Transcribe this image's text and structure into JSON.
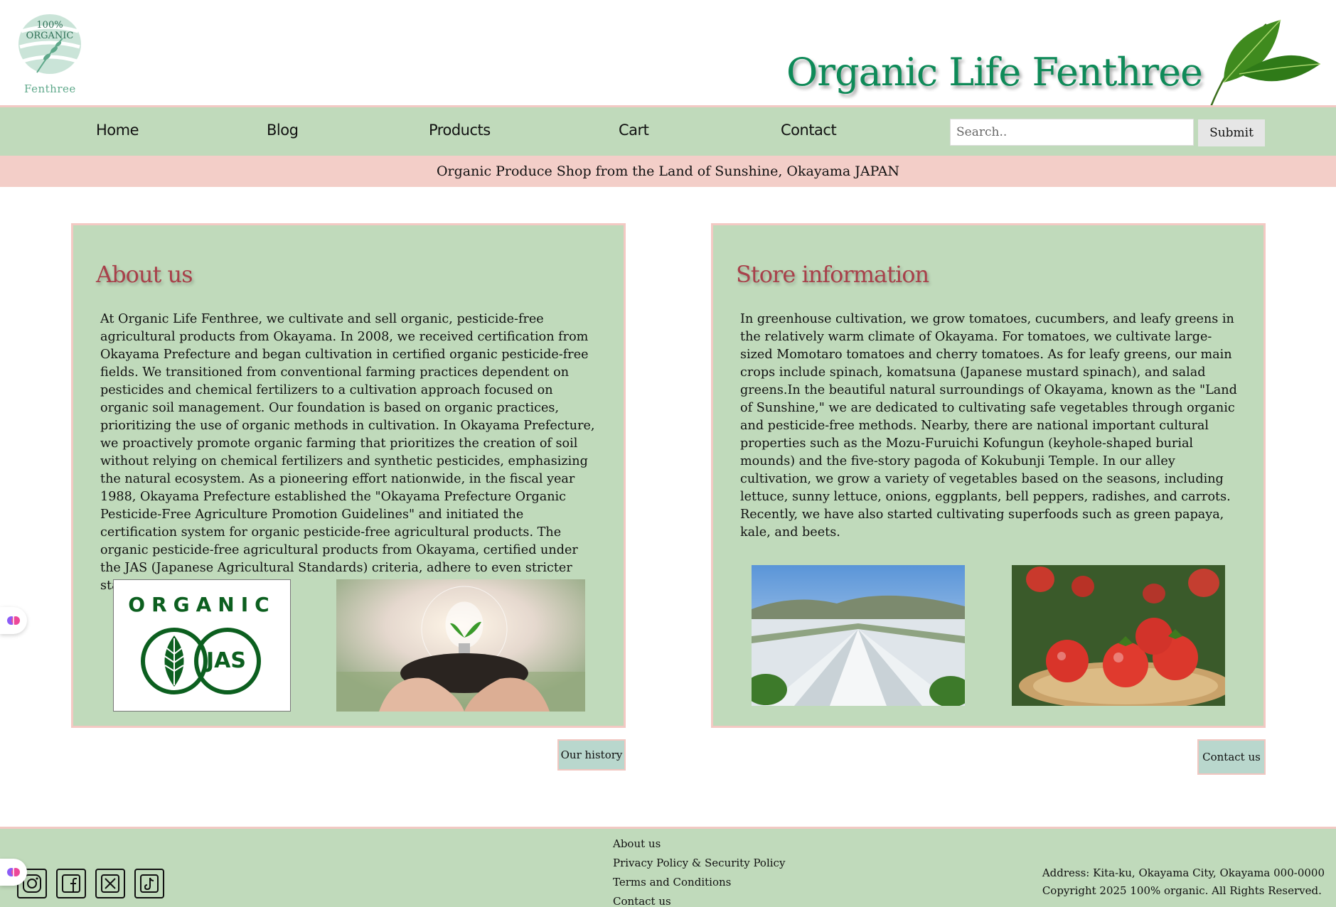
{
  "header": {
    "logo_badge": "100% ORGANIC",
    "logo_name": "Fenthree",
    "title": "Organic Life Fenthree"
  },
  "nav": {
    "items": [
      "Home",
      "Blog",
      "Products",
      "Cart",
      "Contact"
    ],
    "search_placeholder": "Search..",
    "submit_label": "Submit"
  },
  "tagline": "Organic Produce Shop from the Land of Sunshine, Okayama JAPAN",
  "about": {
    "title": "About us",
    "body": "At Organic Life Fenthree, we cultivate and sell organic, pesticide-free agricultural products from Okayama. In 2008, we received certification from Okayama Prefecture and began cultivation in certified organic pesticide-free fields. We transitioned from conventional farming practices dependent on pesticides and chemical fertilizers to a cultivation approach focused on organic soil management. Our foundation is based on organic practices, prioritizing the use of organic methods in cultivation. In Okayama Prefecture, we proactively promote organic farming that prioritizes the creation of soil without relying on chemical fertilizers and synthetic pesticides, emphasizing the natural ecosystem. As a pioneering effort nationwide, in the fiscal year 1988, Okayama Prefecture established the \"Okayama Prefecture Organic Pesticide-Free Agriculture Promotion Guidelines\" and initiated the certification system for organic pesticide-free agricultural products. The organic pesticide-free agricultural products from Okayama, certified under the JAS (Japanese Agricultural Standards) criteria, adhere to even stricter standards.",
    "badge_text": "ORGANIC",
    "badge_mark": "JAS",
    "button_label": "Our history"
  },
  "store": {
    "title": "Store information",
    "body": "In greenhouse cultivation, we grow tomatoes, cucumbers, and leafy greens in the relatively warm climate of Okayama. For tomatoes, we cultivate large-sized Momotaro tomatoes and cherry tomatoes. As for leafy greens, our main crops include spinach, komatsuna (Japanese mustard spinach), and salad greens.In the beautiful natural surroundings of Okayama, known as the \"Land of Sunshine,\" we are dedicated to cultivating safe vegetables through organic and pesticide-free methods. Nearby, there are national important cultural properties such as the Mozu-Furuichi Kofungun (keyhole-shaped burial mounds) and the five-story pagoda of Kokubunji Temple. In our alley cultivation, we grow a variety of vegetables based on the seasons, including lettuce, sunny lettuce, onions, eggplants, bell peppers, radishes, and carrots. Recently, we have also started cultivating superfoods such as green papaya, kale, and beets.",
    "button_label": "Contact us"
  },
  "footer": {
    "links": [
      "About us",
      "Privacy Policy & Security Policy",
      "Terms and Conditions",
      "Contact us"
    ],
    "address": "Address: Kita-ku, Okayama City, Okayama 000-0000",
    "copyright": "Copyright 2025 100% organic. All Rights Reserved.",
    "social_icons": [
      "instagram-icon",
      "facebook-icon",
      "x-icon",
      "tiktok-icon"
    ]
  },
  "colors": {
    "accent_green": "#c0dabb",
    "accent_pink": "#f3cec8",
    "title_green": "#0e8a58",
    "heading_red": "#a8404a"
  }
}
